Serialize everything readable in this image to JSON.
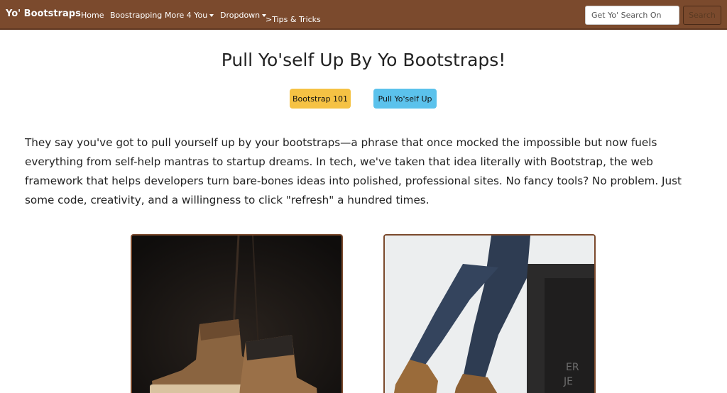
{
  "navbar": {
    "brand": "Yo' Bootstraps",
    "links": [
      "Home",
      "Boostrapping",
      "More 4 You",
      "Dropdown",
      ">Tips & Tricks"
    ],
    "search_placeholder": "Get Yo' Search On",
    "search_button": "Search"
  },
  "main": {
    "title": "Pull Yo'self Up By Yo Bootstraps!",
    "buttons": [
      "Bootstrap 101",
      "Pull Yo'self Up"
    ],
    "intro": "They say you've got to pull yourself up by your bootstraps—a phrase that once mocked the impossible but now fuels everything from self-help mantras to startup dreams. In tech, we've taken that idea literally with Bootstrap, the web framework that helps developers turn bare-bones ideas into polished, professional sites. No fancy tools? No problem. Just some code, creativity, and a willingness to click \"refresh\" a hundred times."
  },
  "colors": {
    "navbar": "#7b4a2d",
    "button_yellow": "#f5c244",
    "button_blue": "#5bc2ec",
    "card_border": "#7b4a2d"
  }
}
